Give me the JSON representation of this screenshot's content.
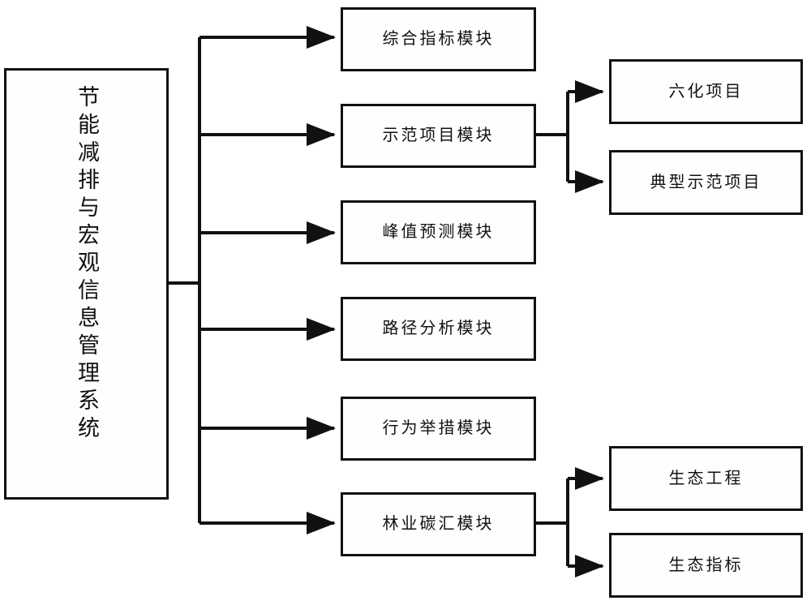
{
  "diagram": {
    "type": "tree-block-diagram",
    "orientation": "left-to-right",
    "line_color": "#111111",
    "box_fill": "#fefefe",
    "root": {
      "id": "root",
      "label": "节能减排与宏观信息管理系统",
      "text_direction": "vertical"
    },
    "level2": [
      {
        "id": "mid-0",
        "label": "综合指标模块"
      },
      {
        "id": "mid-1",
        "label": "示范项目模块"
      },
      {
        "id": "mid-2",
        "label": "峰值预测模块"
      },
      {
        "id": "mid-3",
        "label": "路径分析模块"
      },
      {
        "id": "mid-4",
        "label": "行为举措模块"
      },
      {
        "id": "mid-5",
        "label": "林业碳汇模块"
      }
    ],
    "level3": [
      {
        "id": "right-0",
        "label": "六化项目",
        "parent": "mid-1"
      },
      {
        "id": "right-1",
        "label": "典型示范项目",
        "parent": "mid-1"
      },
      {
        "id": "right-2",
        "label": "生态工程",
        "parent": "mid-5"
      },
      {
        "id": "right-3",
        "label": "生态指标",
        "parent": "mid-5"
      }
    ],
    "edges": [
      {
        "from": "root",
        "to": "mid-0"
      },
      {
        "from": "root",
        "to": "mid-1"
      },
      {
        "from": "root",
        "to": "mid-2"
      },
      {
        "from": "root",
        "to": "mid-3"
      },
      {
        "from": "root",
        "to": "mid-4"
      },
      {
        "from": "root",
        "to": "mid-5"
      },
      {
        "from": "mid-1",
        "to": "right-0"
      },
      {
        "from": "mid-1",
        "to": "right-1"
      },
      {
        "from": "mid-5",
        "to": "right-2"
      },
      {
        "from": "mid-5",
        "to": "right-3"
      }
    ]
  }
}
